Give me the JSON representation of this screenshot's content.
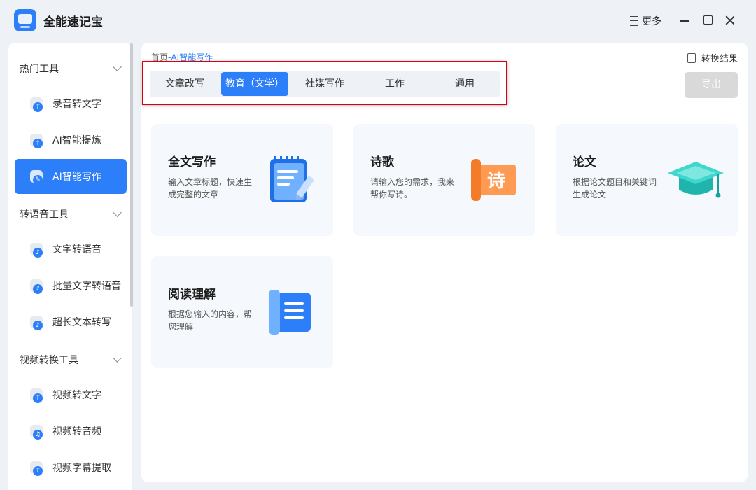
{
  "app": {
    "title": "全能速记宝",
    "more_label": "更多"
  },
  "sidebar": {
    "groups": [
      {
        "label": "热门工具",
        "items": [
          {
            "label": "录音转文字",
            "icon": "T"
          },
          {
            "label": "AI智能提炼",
            "icon": "↑"
          },
          {
            "label": "AI智能写作",
            "icon": "✎",
            "active": true
          }
        ]
      },
      {
        "label": "转语音工具",
        "items": [
          {
            "label": "文字转语音",
            "icon": "♪"
          },
          {
            "label": "批量文字转语音",
            "icon": "♪"
          },
          {
            "label": "超长文本转写",
            "icon": "♪"
          }
        ]
      },
      {
        "label": "视频转换工具",
        "items": [
          {
            "label": "视频转文字",
            "icon": "T"
          },
          {
            "label": "视频转音频",
            "icon": "♫"
          },
          {
            "label": "视频字幕提取",
            "icon": "T"
          }
        ]
      }
    ]
  },
  "main": {
    "breadcrumb": {
      "home": "首页",
      "sep": "-",
      "current": "AI智能写作"
    },
    "result_label": "转换结果",
    "export_label": "导出",
    "tabs": [
      {
        "label": "文章改写"
      },
      {
        "label": "教育（文学）",
        "active": true
      },
      {
        "label": "社媒写作"
      },
      {
        "label": "工作"
      },
      {
        "label": "通用"
      }
    ],
    "cards": [
      {
        "title": "全文写作",
        "desc": "输入文章标题，快速生成完整的文章",
        "icon": "notepad-pen-icon"
      },
      {
        "title": "诗歌",
        "desc": "请输入您的需求，我来帮你写诗。",
        "icon": "poem-scroll-icon",
        "icon_text": "诗"
      },
      {
        "title": "论文",
        "desc": "根据论文题目和关键词生成论文",
        "icon": "graduation-cap-icon"
      },
      {
        "title": "阅读理解",
        "desc": "根据您输入的内容，帮您理解",
        "icon": "reading-scroll-icon"
      }
    ]
  },
  "colors": {
    "accent": "#2d7ff9",
    "highlight_border": "#d9000f",
    "poem_orange": "#f47b2a",
    "cap_teal": "#2fc9c0"
  }
}
